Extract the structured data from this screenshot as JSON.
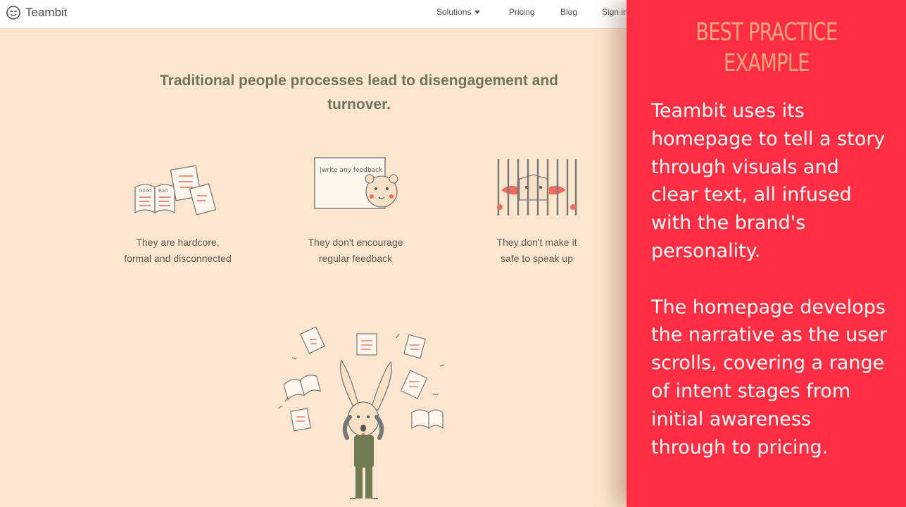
{
  "site": {
    "brand": "Teambit",
    "nav": {
      "solutions": "Solutions",
      "pricing": "Pricing",
      "blog": "Blog",
      "signin": "Sign in"
    },
    "headline": "Traditional people processes lead to disengagement and turnover.",
    "features": [
      {
        "icon": "paper-forms-icon",
        "caption_line1": "They are hardcore,",
        "caption_line2": "formal and disconnected"
      },
      {
        "icon": "feedback-bear-icon",
        "board_text": "|write any feedback",
        "caption_line1": "They don't encourage",
        "caption_line2": "regular feedback"
      },
      {
        "icon": "caged-cat-icon",
        "caption_line1": "They don't make it",
        "caption_line2": "safe to speak up"
      }
    ],
    "hero_icon": "stressed-rabbit-illustration",
    "colors": {
      "background": "#fde6cf",
      "headline": "#6f7559",
      "accent": "#f06b5e"
    }
  },
  "panel": {
    "title_line1": "BEST PRACTICE",
    "title_line2": "EXAMPLE",
    "paragraph1": "Teambit uses its homepage to tell a story through visuals and clear text, all infused with the brand's personality.",
    "paragraph2": "The homepage develops the narrative as the user scrolls, covering a range of intent stages from initial awareness through to pricing.",
    "colors": {
      "background": "#ff2e43",
      "title": "#f4a77f",
      "text": "#ffffff"
    }
  }
}
